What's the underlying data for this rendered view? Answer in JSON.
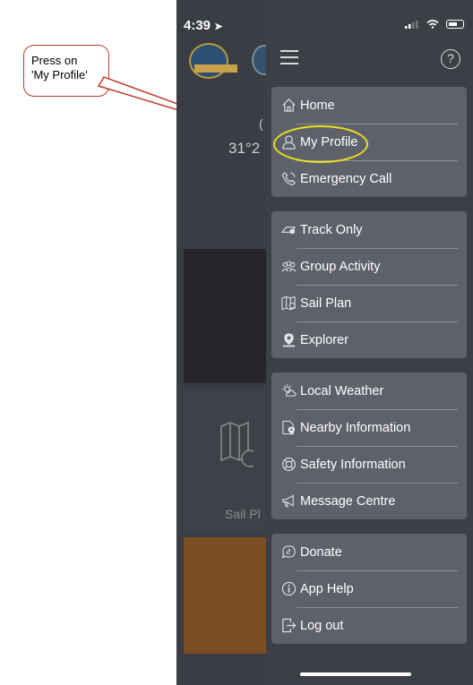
{
  "callout": {
    "text_line1": "Press on",
    "text_line2": "'My Profile'"
  },
  "status_bar": {
    "time": "4:39",
    "location_arrow": "➤"
  },
  "background_app": {
    "temperature": "31°2",
    "paren": "(",
    "sail_label": "Sail Pl"
  },
  "header": {
    "help_symbol": "?"
  },
  "menu": {
    "group1": [
      {
        "label": "Home",
        "icon": "home-icon"
      },
      {
        "label": "My Profile",
        "icon": "user-icon"
      },
      {
        "label": "Emergency Call",
        "icon": "phone-icon"
      }
    ],
    "group2": [
      {
        "label": "Track Only",
        "icon": "track-icon"
      },
      {
        "label": "Group Activity",
        "icon": "group-icon"
      },
      {
        "label": "Sail Plan",
        "icon": "map-icon"
      },
      {
        "label": "Explorer",
        "icon": "pin-icon"
      }
    ],
    "group3": [
      {
        "label": "Local Weather",
        "icon": "weather-icon"
      },
      {
        "label": "Nearby Information",
        "icon": "document-pin-icon"
      },
      {
        "label": "Safety Information",
        "icon": "lifebuoy-icon"
      },
      {
        "label": "Message Centre",
        "icon": "megaphone-icon"
      }
    ],
    "group4": [
      {
        "label": "Donate",
        "icon": "donate-icon"
      },
      {
        "label": "App Help",
        "icon": "info-icon"
      },
      {
        "label": "Log out",
        "icon": "logout-icon"
      }
    ]
  },
  "colors": {
    "drawer_bg": "#3c3f46",
    "group_bg": "#5e6169",
    "highlight": "#e8e020",
    "callout_border": "#c0392b"
  }
}
